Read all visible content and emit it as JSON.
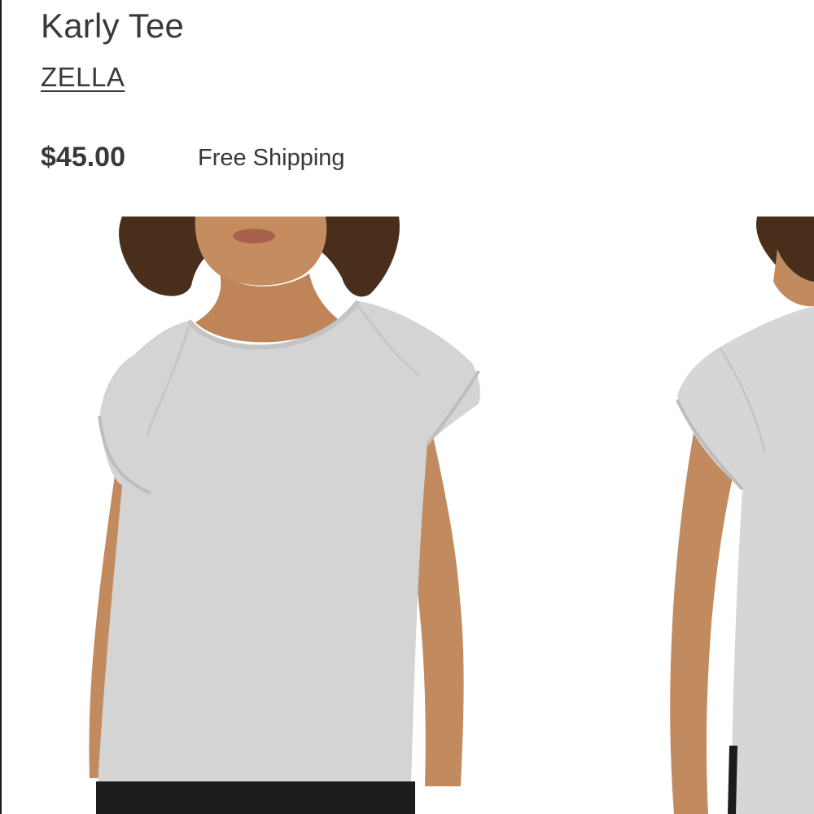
{
  "product": {
    "title": "Karly Tee",
    "brand": "ZELLA",
    "price": "$45.00",
    "shipping": "Free Shipping"
  },
  "gallery": {
    "images": [
      {
        "name": "front-view"
      },
      {
        "name": "back-view"
      }
    ],
    "colors": {
      "shirt": "#d4d4d4",
      "skin": "#c28a5f",
      "hair": "#4a2e1c",
      "pants": "#1c1c1c"
    }
  }
}
